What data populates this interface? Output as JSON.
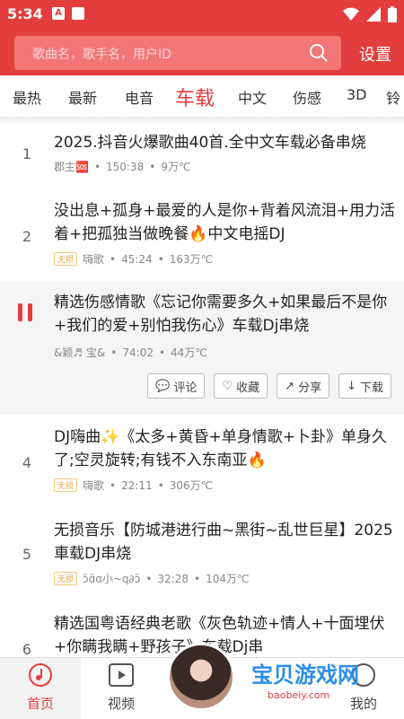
{
  "status_bar": {
    "time": "5:34"
  },
  "search": {
    "placeholder": "歌曲名，歌手名，用户ID",
    "settings_label": "设置"
  },
  "tabs": [
    "最热",
    "最新",
    "电音",
    "车载",
    "中文",
    "伤感",
    "3D",
    "铃"
  ],
  "active_tab": "车载",
  "songs": [
    {
      "index": "1",
      "title": "2025.抖音火爆歌曲40首.全中文车载必备串烧",
      "author": "郡主🆘",
      "duration": "150:38",
      "plays": "9万℃",
      "badge": ""
    },
    {
      "index": "2",
      "title": "没出息+孤身+最爱的人是你+背着风流泪+用力活着+把孤独当做晚餐🔥中文电摇DJ",
      "author": "嗨歌",
      "duration": "45:24",
      "plays": "163万℃",
      "badge": "无损"
    },
    {
      "index": "",
      "title": "精选伤感情歌《忘记你需要多久+如果最后不是你+我们的爱+别怕我伤心》车载Dj串烧",
      "author": "&颖♬ 宝&",
      "duration": "74:02",
      "plays": "44万℃",
      "badge": ""
    },
    {
      "index": "4",
      "title": "DJ嗨曲✨《太多+黄昏+单身情歌+卜卦》单身久了;空灵旋转;有钱不入东南亚🔥",
      "author": "嗨歌",
      "duration": "22:11",
      "plays": "306万℃",
      "badge": "无损"
    },
    {
      "index": "5",
      "title": "无损音乐【防城港进行曲~黑街~乱世巨星】2025車载DJ串烧",
      "author": "ɔ̄ɑ̄ɑ小~q∂ɔ̄",
      "duration": "32:28",
      "plays": "104万℃",
      "badge": "无损"
    },
    {
      "index": "6",
      "title": "精选国粤语经典老歌《灰色轨迹+情人+十面埋伏+你瞒我瞒+野孩子》车载Dj串",
      "author": "",
      "duration": "",
      "plays": "",
      "badge": ""
    }
  ],
  "actions": {
    "comment": "评论",
    "favorite": "收藏",
    "share": "分享",
    "download": "下载"
  },
  "bottom_nav": {
    "home": "首页",
    "video": "视频",
    "mine": "我的"
  },
  "watermark": {
    "title": "宝贝游戏网",
    "url": "baobeiy.com"
  },
  "colors": {
    "brand": "#e43d3d"
  }
}
